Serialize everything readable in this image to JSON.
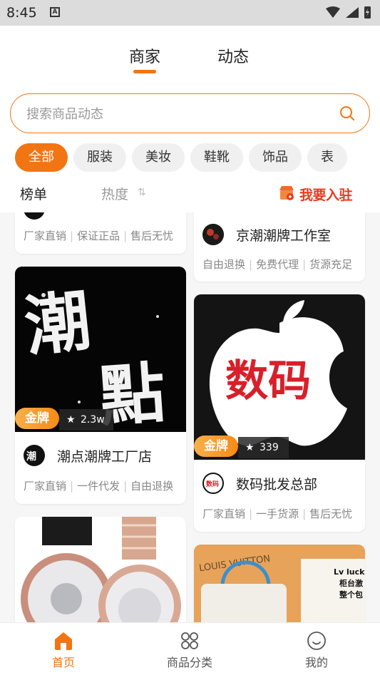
{
  "status_bar": {
    "time": "8:45",
    "notification_icon": "A"
  },
  "top_tabs": [
    {
      "label": "商家",
      "active": true
    },
    {
      "label": "动态",
      "active": false
    }
  ],
  "search": {
    "placeholder": "搜索商品动态"
  },
  "categories": [
    {
      "label": "全部",
      "active": true
    },
    {
      "label": "服装",
      "active": false
    },
    {
      "label": "美妆",
      "active": false
    },
    {
      "label": "鞋靴",
      "active": false
    },
    {
      "label": "饰品",
      "active": false
    },
    {
      "label": "表",
      "active": false
    }
  ],
  "filters": {
    "rank": "榜单",
    "hot": "热度",
    "join": "我要入驻"
  },
  "feed": {
    "left": [
      {
        "tags": [
          "厂家直销",
          "保证正品",
          "售后无忧"
        ],
        "image": "partial"
      },
      {
        "store_name": "潮点潮牌工厂店",
        "badge": "金牌",
        "favorites": "2.3w",
        "image_text": "潮點",
        "tags": [
          "厂家直销",
          "一件代发",
          "自由退换"
        ]
      },
      {
        "image": "watches"
      }
    ],
    "right": [
      {
        "store_name": "京潮潮牌工作室",
        "tags": [
          "自由退换",
          "免费代理",
          "货源充足"
        ]
      },
      {
        "store_name": "数码批发总部",
        "badge": "金牌",
        "favorites": "339",
        "image_text": "数码",
        "avatar_text": "数码",
        "tags": [
          "厂家直销",
          "一手货源",
          "售后无忧"
        ]
      },
      {
        "image": "bag",
        "image_text": "Lv lucky 柜台激 整个包"
      }
    ]
  },
  "bottom_nav": [
    {
      "label": "首页",
      "icon": "home-icon",
      "active": true
    },
    {
      "label": "商品分类",
      "icon": "category-icon",
      "active": false
    },
    {
      "label": "我的",
      "icon": "profile-icon",
      "active": false
    }
  ],
  "colors": {
    "accent": "#f27513",
    "join_red": "#ea3a1c",
    "badge_gold": "#f58a16"
  }
}
